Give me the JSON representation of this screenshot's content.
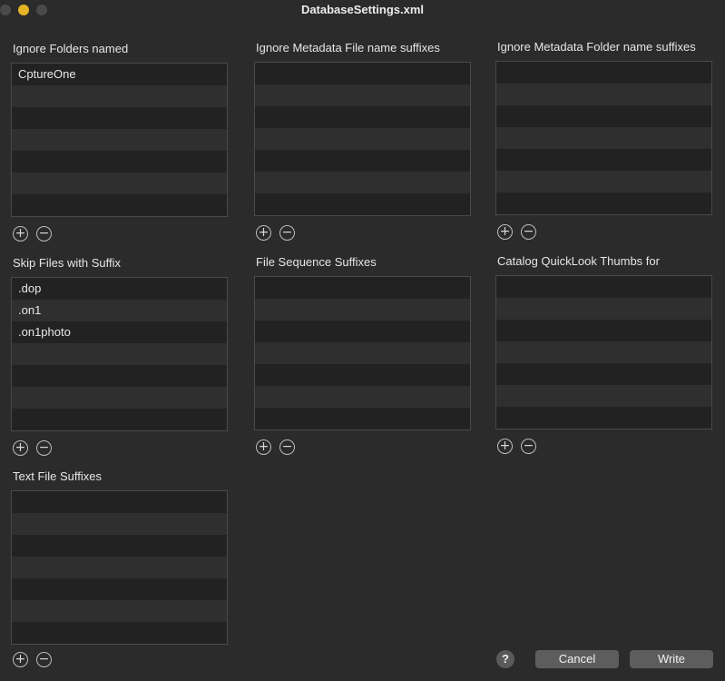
{
  "window": {
    "title": "DatabaseSettings.xml"
  },
  "sections": [
    {
      "label": "Ignore Folders named",
      "items": [
        "CptureOne"
      ]
    },
    {
      "label": "Ignore Metadata File name suffixes",
      "items": []
    },
    {
      "label": "Ignore Metadata Folder name suffixes",
      "items": []
    },
    {
      "label": "Skip Files with Suffix",
      "items": [
        ".dop",
        ".on1",
        ".on1photo"
      ]
    },
    {
      "label": "File Sequence Suffixes",
      "items": []
    },
    {
      "label": "Catalog QuickLook Thumbs for",
      "items": []
    },
    {
      "label": "Text File Suffixes",
      "items": []
    }
  ],
  "controls": {
    "add_glyph": "+",
    "remove_glyph": "−"
  },
  "buttons": {
    "help": "?",
    "cancel": "Cancel",
    "write": "Write"
  }
}
